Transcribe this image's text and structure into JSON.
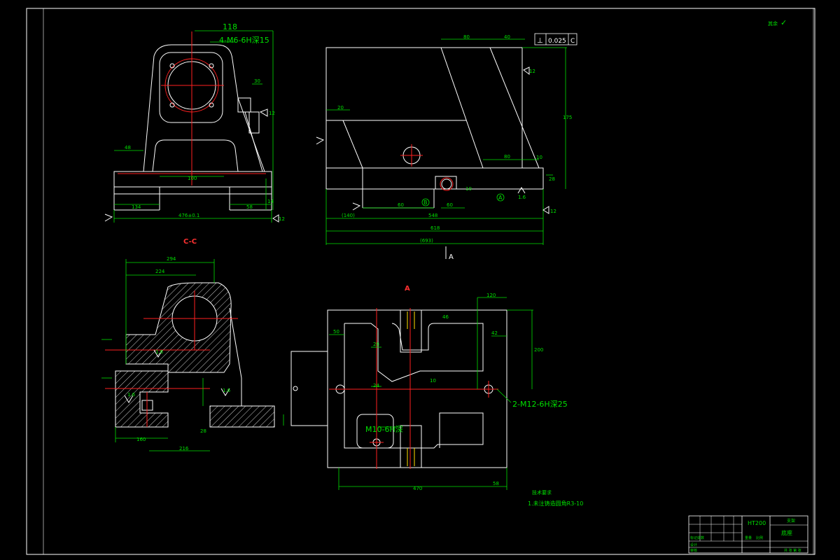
{
  "drawing": {
    "background": "#000000",
    "colors": {
      "geometry": "#ffffff",
      "dimension": "#00e000",
      "centerline": "#ff2020",
      "thread": "#ffe000"
    },
    "section_label": "C-C",
    "view_label": "A",
    "view_label_top_right": "A",
    "top_right_mark": "其余",
    "roughness_symbol_top_right": "✓",
    "tolerance_frame": {
      "symbol": "⊥",
      "value": "0.025",
      "datum": "C"
    },
    "labels": {
      "left_top": {
        "w118": "118",
        "threads": "4-M6-6H深15",
        "w476": "476±0.1",
        "w134": "134",
        "w58": "58",
        "w48": "48",
        "w30": "30",
        "w14": "14",
        "w100": "100",
        "ra": "12",
        "ra2": "12"
      },
      "right_top": {
        "w80": "80",
        "w40": "40",
        "w80b": "80",
        "w60": "60",
        "w28": "28",
        "w10": "10",
        "w20": "20",
        "w175": "175",
        "w548": "548",
        "w618": "618",
        "w693": "(693)",
        "w140": "(140)",
        "r16": "1.6",
        "r12": "12",
        "datum_b": "B",
        "datum_a": "A",
        "r12b": "12"
      },
      "section": {
        "w294": "294",
        "w224": "224",
        "w160": "160",
        "w216": "216",
        "w28": "28",
        "r16a": "1.6",
        "r16b": "1.6",
        "r16c": "1.6"
      },
      "bottom_view": {
        "w50": "50",
        "w46": "46",
        "w42": "42",
        "w28": "28",
        "w24": "24",
        "w10": "10",
        "w470": "470",
        "w58": "58",
        "thread_m12": "2-M12-6H深25",
        "thread_m10": "M10-6H深",
        "w120": "120",
        "w200": "200"
      }
    },
    "notes": {
      "heading": "技术要求",
      "item1": "1.未注铸造圆角R3-10"
    },
    "title_block": {
      "part_name": "支架",
      "material": "HT200",
      "drawing_title": "底座",
      "row1": "标记处数",
      "row2": "设计",
      "row3": "审核",
      "row4": "工艺",
      "weight": "重量",
      "scale": "比例",
      "sheet": "共 张 第 张"
    }
  }
}
